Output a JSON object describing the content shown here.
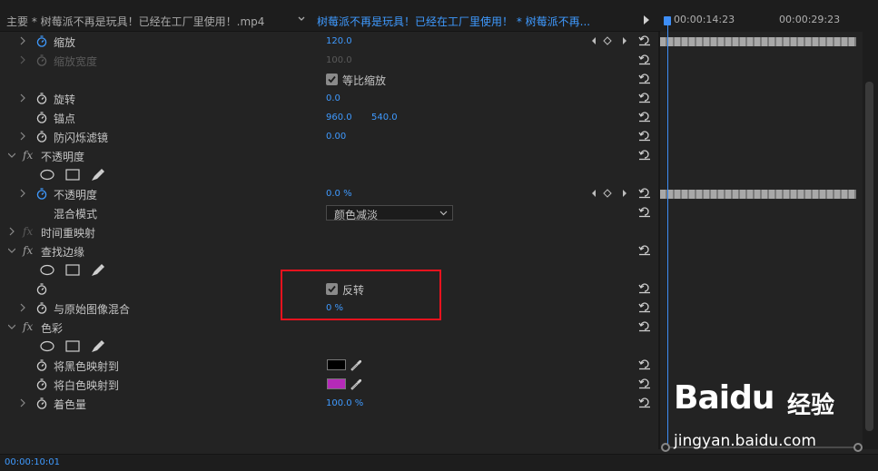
{
  "header": {
    "source_label": "主要 * 树莓派不再是玩具！已经在工厂里使用！.mp4",
    "clip_label": "树莓派不再是玩具！已经在工厂里使用！ * 树莓派不再...",
    "timecode_1": "00:00:14:23",
    "timecode_2": "00:00:29:23"
  },
  "rows": {
    "scale": {
      "label": "缩放",
      "value": "120.0"
    },
    "scale_width": {
      "label": "缩放宽度",
      "value": "100.0"
    },
    "uniform_scale": {
      "label": "等比缩放"
    },
    "rotation": {
      "label": "旋转",
      "value": "0.0"
    },
    "anchor": {
      "label": "锚点",
      "value_x": "960.0",
      "value_y": "540.0"
    },
    "antiflicker": {
      "label": "防闪烁滤镜",
      "value": "0.00"
    },
    "opacity_section": {
      "fx": "fx",
      "label": "不透明度"
    },
    "opacity": {
      "label": "不透明度",
      "value": "0.0 %"
    },
    "blend_mode": {
      "label": "混合模式",
      "value": "颜色减淡"
    },
    "time_remap": {
      "fx": "fx",
      "label": "时间重映射"
    },
    "find_edges": {
      "fx": "fx",
      "label": "查找边缘"
    },
    "invert": {
      "label": "反转"
    },
    "blend_original": {
      "label": "与原始图像混合",
      "value": "0 %"
    },
    "tint": {
      "fx": "fx",
      "label": "色彩"
    },
    "map_black": {
      "label": "将黑色映射到",
      "color": "#000000"
    },
    "map_white": {
      "label": "将白色映射到",
      "color": "#b52ab8"
    },
    "amount": {
      "label": "着色量",
      "value": "100.0 %"
    }
  },
  "footer": {
    "timecode": "00:00:10:01"
  },
  "watermark": {
    "logo_a": "Bai",
    "logo_b": "du",
    "cn": "经验",
    "url": "jingyan.baidu.com"
  },
  "colors": {
    "accent": "#3f9aff",
    "highlight": "#e8121e",
    "playhead": "#3e8ef7"
  }
}
